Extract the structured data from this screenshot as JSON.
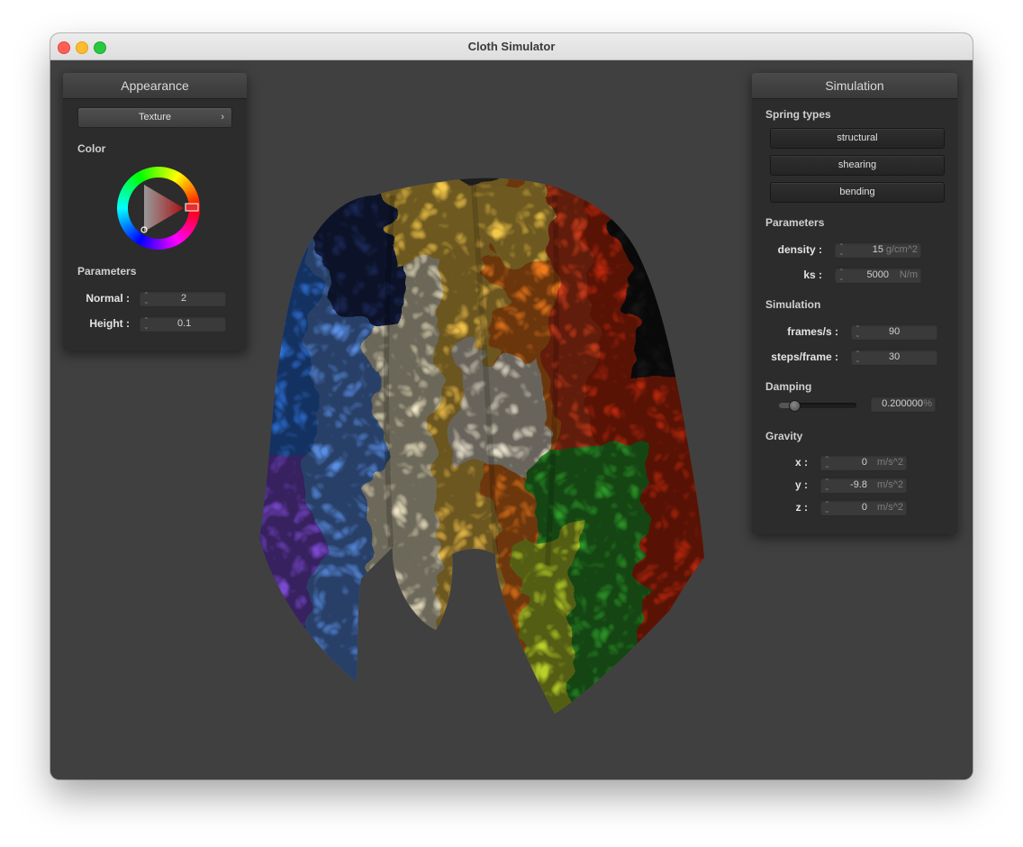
{
  "window": {
    "title": "Cloth Simulator"
  },
  "appearance": {
    "header": "Appearance",
    "texture_label": "Texture",
    "color_label": "Color",
    "parameters_label": "Parameters",
    "normal": {
      "label": "Normal :",
      "value": "2"
    },
    "height": {
      "label": "Height :",
      "value": "0.1"
    },
    "selected_color": "#ff0000"
  },
  "simulation": {
    "header": "Simulation",
    "spring_types_label": "Spring types",
    "spring_buttons": [
      "structural",
      "shearing",
      "bending"
    ],
    "parameters_label": "Parameters",
    "density": {
      "label": "density :",
      "value": "15",
      "unit": "g/cm^2"
    },
    "ks": {
      "label": "ks :",
      "value": "5000",
      "unit": "N/m"
    },
    "simulation_label": "Simulation",
    "frames": {
      "label": "frames/s :",
      "value": "90"
    },
    "steps": {
      "label": "steps/frame :",
      "value": "30"
    },
    "damping_label": "Damping",
    "damping": {
      "value": "0.200000",
      "unit": "%",
      "slider_fraction": 0.2
    },
    "gravity_label": "Gravity",
    "gravity": {
      "x": {
        "label": "x :",
        "value": "0",
        "unit": "m/s^2"
      },
      "y": {
        "label": "y :",
        "value": "-9.8",
        "unit": "m/s^2"
      },
      "z": {
        "label": "z :",
        "value": "0",
        "unit": "m/s^2"
      }
    }
  },
  "colors": {
    "background": "#404040",
    "panel": "#2c2c2c",
    "accent_red": "#e03030"
  }
}
